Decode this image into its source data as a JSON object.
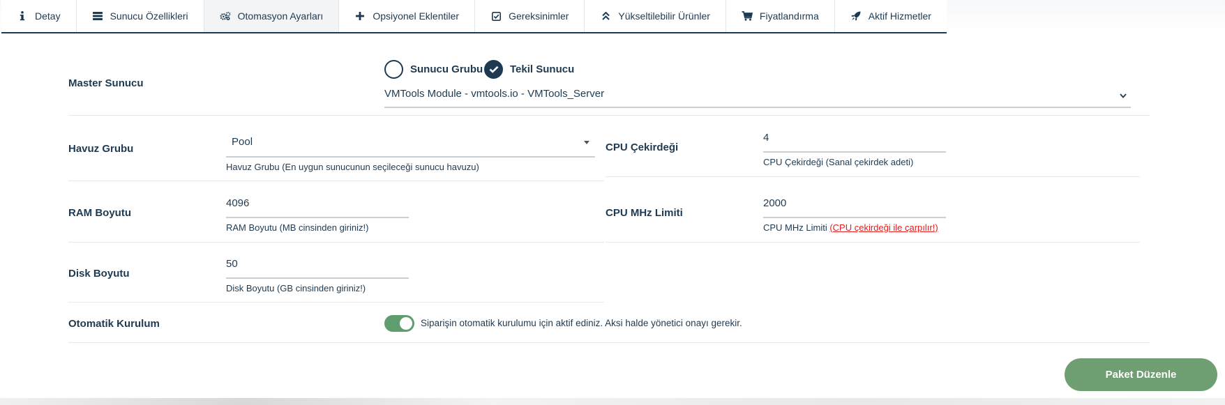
{
  "tabs": [
    {
      "label": "Detay",
      "icon": "info-icon"
    },
    {
      "label": "Sunucu Özellikleri",
      "icon": "server-icon"
    },
    {
      "label": "Otomasyon Ayarları",
      "icon": "cogs-icon",
      "active": true
    },
    {
      "label": "Opsiyonel Eklentiler",
      "icon": "plus-icon"
    },
    {
      "label": "Gereksinimler",
      "icon": "check-square-icon"
    },
    {
      "label": "Yükseltilebilir Ürünler",
      "icon": "double-chevron-up-icon"
    },
    {
      "label": "Fiyatlandırma",
      "icon": "cart-icon"
    },
    {
      "label": "Aktif Hizmetler",
      "icon": "rocket-icon"
    }
  ],
  "master": {
    "label": "Master Sunucu",
    "radio_group": "Sunucu Grubu",
    "radio_single": "Tekil Sunucu",
    "selected": "Tekil Sunucu",
    "server_value": "VMTools Module - vmtools.io - VMTools_Server"
  },
  "pool": {
    "label": "Havuz Grubu",
    "value": "Pool",
    "help": "Havuz Grubu (En uygun sunucunun seçileceği sunucu havuzu)"
  },
  "cpu_core": {
    "label": "CPU Çekirdeği",
    "value": "4",
    "help": "CPU Çekirdeği (Sanal çekirdek adeti)"
  },
  "ram": {
    "label": "RAM Boyutu",
    "value": "4096",
    "help": "RAM Boyutu (MB cinsinden giriniz!)"
  },
  "cpu_mhz": {
    "label": "CPU MHz Limiti",
    "value": "2000",
    "help_prefix": "CPU MHz Limiti ",
    "help_warn": "(CPU çekirdeği ile çarpılır!)"
  },
  "disk": {
    "label": "Disk Boyutu",
    "value": "50",
    "help": "Disk Boyutu (GB cinsinden giriniz!)"
  },
  "auto_setup": {
    "label": "Otomatik Kurulum",
    "enabled": true,
    "description": "Siparişin otomatik kurulumu için aktif ediniz. Aksi halde yönetici onayı gerekir."
  },
  "submit_label": "Paket Düzenle",
  "colors": {
    "primary": "#1e3a52",
    "toggle_on": "#5f9d6f",
    "button": "#6e9e72",
    "warning": "#e02020"
  }
}
